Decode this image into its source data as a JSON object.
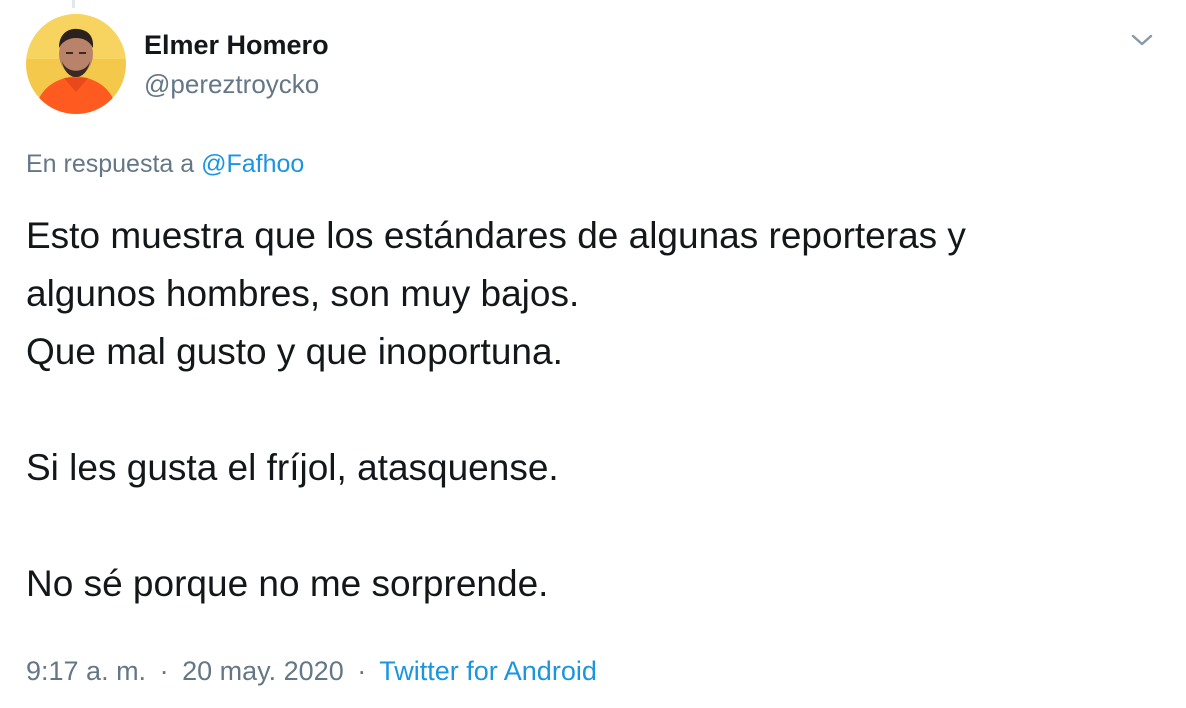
{
  "user": {
    "display_name": "Elmer Homero",
    "handle": "@pereztroycko",
    "avatar": "profile-photo"
  },
  "menu": {
    "icon": "chevron-down-icon"
  },
  "reply": {
    "prefix": "En respuesta a",
    "target": "@Fafhoo"
  },
  "tweet": {
    "lines": [
      "Esto muestra que los estándares de algunas reporteras y",
      "algunos hombres, son muy bajos.",
      "Que mal gusto y que inoportuna.",
      "",
      "Si les gusta el fríjol, atasquense.",
      "",
      "No sé porque no me sorprende."
    ]
  },
  "meta": {
    "time": "9:17 a. m.",
    "date": "20 may. 2020",
    "separator": "·",
    "source": "Twitter for Android"
  },
  "colors": {
    "text": "#14171a",
    "secondary": "#657786",
    "link": "#1b95e0",
    "avatar_shirt": "#ff5a1f"
  }
}
